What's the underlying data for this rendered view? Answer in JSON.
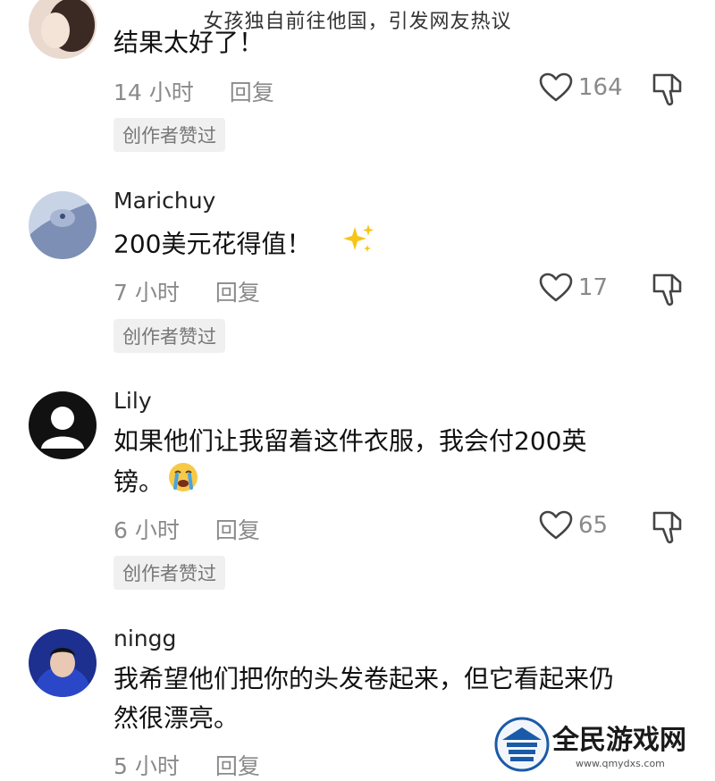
{
  "page": {
    "title": "女孩独自前往他国，引发网友热议"
  },
  "comments": [
    {
      "username": "",
      "text": "结果太好了！",
      "time": "14 小时",
      "reply": "回复",
      "likes": "164",
      "badge": "创作者赞过"
    },
    {
      "username": "Marichuy",
      "text": "200美元花得值！",
      "time": "7 小时",
      "reply": "回复",
      "likes": "17",
      "badge": "创作者赞过",
      "emoji": "sparkles"
    },
    {
      "username": "Lily",
      "text_line1": "如果他们让我留着这件衣服，我会付200英",
      "text_line2": "镑。",
      "time": "6 小时",
      "reply": "回复",
      "likes": "65",
      "badge": "创作者赞过",
      "emoji": "loudly-crying-face"
    },
    {
      "username": "ningg",
      "text_line1": "我希望他们把你的头发卷起来，但它看起来仍",
      "text_line2": "然很漂亮。",
      "time": "5 小时",
      "reply": "回复"
    }
  ],
  "watermark": {
    "brand": "全民游戏网",
    "url": "www.qmydxs.com"
  },
  "colors": {
    "meta_gray": "#8a8a8a",
    "badge_bg": "#f0f0f0",
    "watermark_blue": "#1a5aa8"
  }
}
